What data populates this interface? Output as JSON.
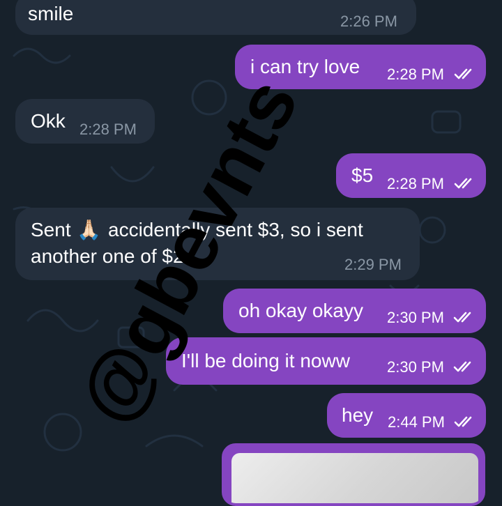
{
  "messages": [
    {
      "text": "smile",
      "time": "2:26 PM"
    },
    {
      "text": "i can try love",
      "time": "2:28 PM"
    },
    {
      "text": "Okk",
      "time": "2:28 PM"
    },
    {
      "text": "$5",
      "time": "2:28 PM"
    },
    {
      "line1_a": "Sent",
      "line1_b": "accidentally sent $3, so i sent",
      "line2": "another one of $2",
      "time": "2:29 PM"
    },
    {
      "text": "oh okay okayy",
      "time": "2:30 PM"
    },
    {
      "text": "I'll be doing it noww",
      "time": "2:30 PM"
    },
    {
      "text": "hey",
      "time": "2:44 PM"
    }
  ],
  "emoji": "🙏🏻",
  "watermark": "@gbevnts",
  "colors": {
    "background": "#17212b",
    "incoming": "#242f3d",
    "outgoing": "#8545c1"
  },
  "icons": {
    "read_receipt": "double-check-icon"
  }
}
